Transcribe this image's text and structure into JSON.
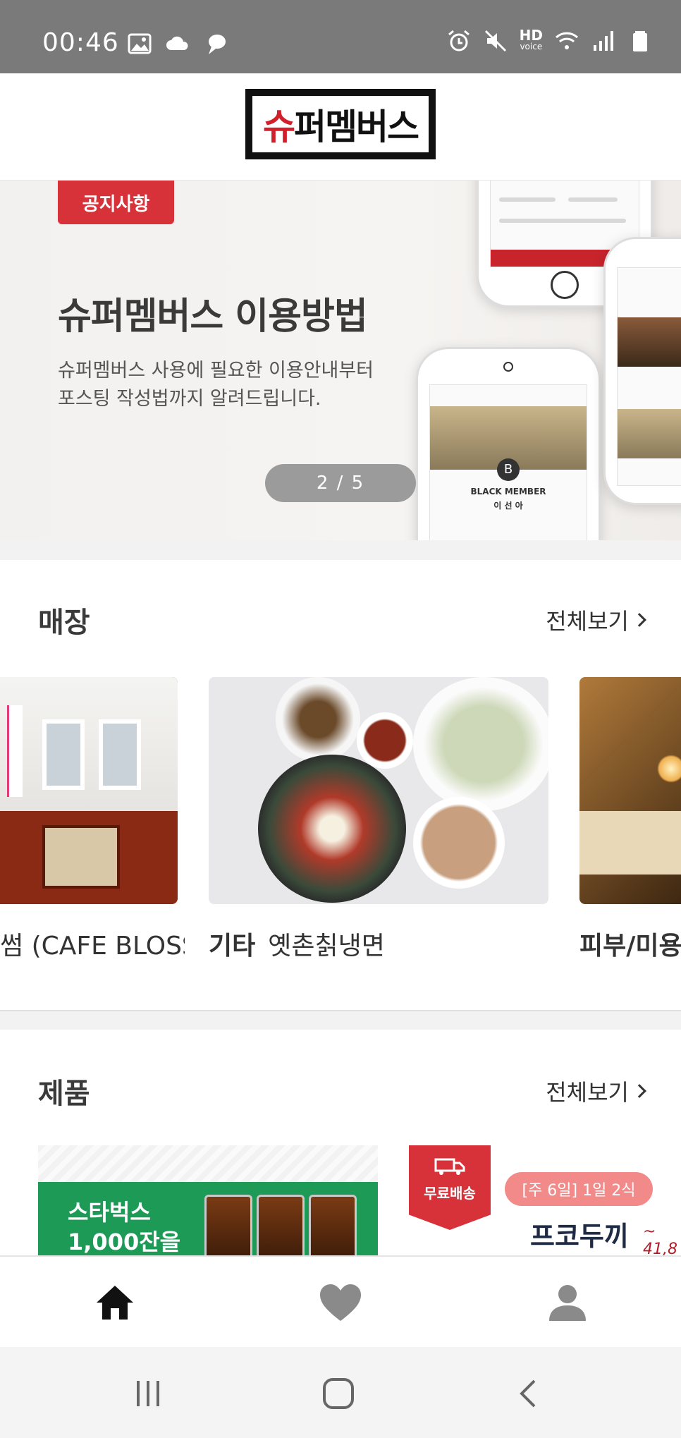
{
  "status_bar": {
    "time": "00:46",
    "left_icons": [
      "image-icon",
      "cloud-icon",
      "chat-icon"
    ],
    "right_icons": [
      "alarm-icon",
      "mute-icon",
      "hd-voice-icon",
      "wifi-icon",
      "signal-icon",
      "battery-icon"
    ],
    "hd_label": "HD",
    "voice_label": "voice"
  },
  "header": {
    "logo_text_red": "슈",
    "logo_text_black": "퍼멤버스"
  },
  "banner": {
    "badge": "공지사항",
    "title": "슈퍼멤버스 이용방법",
    "desc_line1": "슈퍼멤버스 사용에 필요한 이용안내부터",
    "desc_line2": "포스팅 작성법까지 알려드립니다.",
    "pager": "2 / 5",
    "phone_text_1": "BLACK MEMBER",
    "phone_text_2": "이 선 아"
  },
  "stores": {
    "title": "매장",
    "see_all": "전체보기",
    "items": [
      {
        "label": "썸 (CAFE BLOSSOM)"
      },
      {
        "category": "기타",
        "name": "옛촌칡냉면"
      },
      {
        "category": "피부/미용",
        "name": ""
      }
    ]
  },
  "products": {
    "title": "제품",
    "see_all": "전체보기",
    "item1_text_line1": "스타벅스",
    "item1_text_line2": "1,000잔을",
    "item2_ribbon": "무료배송",
    "item2_pill": "[주 6일] 1일 2식",
    "item2_title": "프코두끼",
    "item2_price": "~ 41,8"
  },
  "bottom_nav": {
    "items": [
      "home-icon",
      "heart-icon",
      "person-icon"
    ],
    "active": "home-icon"
  },
  "system_nav": {
    "items": [
      "recents-icon",
      "home-circle-icon",
      "back-icon"
    ]
  },
  "colors": {
    "accent_red": "#d7323a",
    "statusbar_bg": "#7a7a7a",
    "starbucks_green": "#1e9a57"
  }
}
